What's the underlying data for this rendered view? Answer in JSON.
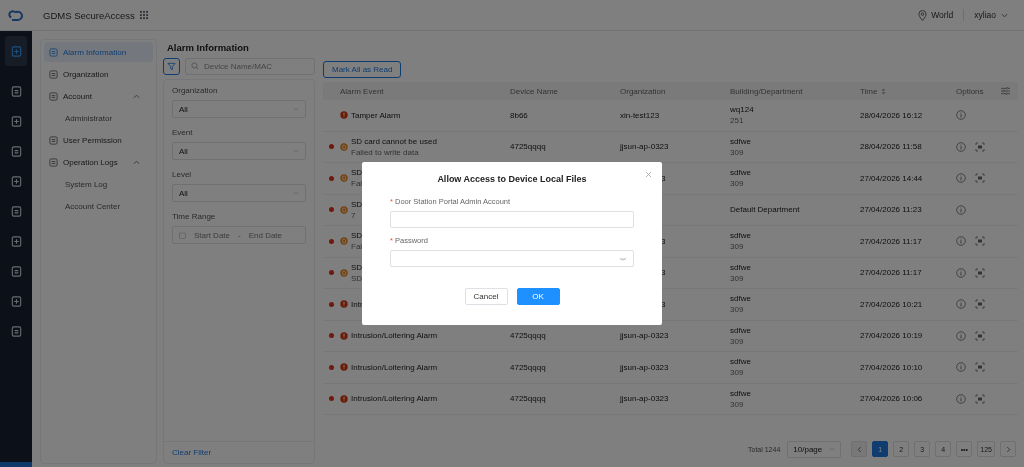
{
  "header": {
    "product": "GDMS SecureAccess",
    "region": "World",
    "user": "xyliao"
  },
  "rail": [
    {
      "selected": true
    },
    {
      "selected": false
    },
    {
      "selected": false
    },
    {
      "selected": false
    },
    {
      "selected": false
    },
    {
      "selected": false
    },
    {
      "selected": false
    },
    {
      "selected": false
    },
    {
      "selected": false
    },
    {
      "selected": false
    }
  ],
  "nav": [
    {
      "label": "Alarm Information",
      "selected": true
    },
    {
      "label": "Organization",
      "selected": false
    },
    {
      "label": "Account",
      "selected": false,
      "expanded": true,
      "children": [
        {
          "label": "Administrator",
          "selected": false
        }
      ]
    },
    {
      "label": "User Permission",
      "selected": false
    },
    {
      "label": "Operation Logs",
      "selected": false,
      "expanded": true,
      "children": [
        {
          "label": "System Log",
          "selected": false
        },
        {
          "label": "Account Center",
          "selected": false
        }
      ]
    }
  ],
  "page_title": "Alarm Information",
  "search": {
    "placeholder": "Device Name/MAC"
  },
  "mark_all_button": "Mark All as Read",
  "filters": [
    {
      "label": "Organization",
      "value": "All"
    },
    {
      "label": "Event",
      "value": "All"
    },
    {
      "label": "Level",
      "value": "All"
    }
  ],
  "time_range": {
    "label": "Time Range",
    "start_placeholder": "Start Date",
    "separator": "-",
    "end_placeholder": "End Date"
  },
  "clear_filter": "Clear Filter",
  "table": {
    "columns": [
      "Alarm Event",
      "Device Name",
      "Organization",
      "Building/Department",
      "Time",
      "Options"
    ],
    "rows": [
      {
        "unread": false,
        "kind": "alert",
        "event": "Tamper Alarm",
        "device": "8b66",
        "organization": "xin-test123",
        "building": "wq124",
        "department": "251",
        "time": "28/04/2026 16:12",
        "capture": false
      },
      {
        "unread": true,
        "kind": "sd_card",
        "event": "SD card cannot be used",
        "detail": "Failed to write data",
        "device": "4725qqqq",
        "organization": "jjsun-ap-0323",
        "building": "sdfwe",
        "department": "309",
        "time": "28/04/2026 11:58",
        "capture": true
      },
      {
        "unread": true,
        "kind": "sd_card",
        "covered": true,
        "event": "SD",
        "detail": "Fai",
        "organization": "3",
        "building": "sdfwe",
        "department": "309",
        "time": "27/04/2026 14:44",
        "capture": true
      },
      {
        "unread": true,
        "kind": "sd_card",
        "covered": true,
        "event": "SD",
        "detail": "7",
        "building": "Default Department",
        "time": "27/04/2026 11:23",
        "capture": false
      },
      {
        "unread": true,
        "kind": "sd_card",
        "covered": true,
        "event": "SD",
        "detail": "Fai",
        "organization": "3",
        "building": "sdfwe",
        "department": "309",
        "time": "27/04/2026 11:17",
        "capture": true
      },
      {
        "unread": true,
        "kind": "sd_card",
        "covered": true,
        "event": "SD",
        "detail": "SD",
        "organization": "3",
        "building": "sdfwe",
        "department": "309",
        "time": "27/04/2026 11:17",
        "capture": true
      },
      {
        "unread": true,
        "kind": "alert",
        "covered": true,
        "event": "Intr",
        "organization": "3",
        "building": "sdfwe",
        "department": "309",
        "time": "27/04/2026 10:21",
        "capture": true
      },
      {
        "unread": true,
        "kind": "alert",
        "event": "Intrusion/Loitering Alarm",
        "device": "4725qqqq",
        "organization": "jjsun-ap-0323",
        "building": "sdfwe",
        "department": "309",
        "time": "27/04/2026 10:19",
        "capture": true
      },
      {
        "unread": true,
        "kind": "alert",
        "event": "Intrusion/Loitering Alarm",
        "device": "4725qqqq",
        "organization": "jjsun-ap-0323",
        "building": "sdfwe",
        "department": "309",
        "time": "27/04/2026 10:10",
        "capture": true
      },
      {
        "unread": true,
        "kind": "alert",
        "event": "Intrusion/Loitering Alarm",
        "device": "4725qqqq",
        "organization": "jjsun-ap-0323",
        "building": "sdfwe",
        "department": "309",
        "time": "27/04/2026 10:06",
        "capture": true
      }
    ]
  },
  "pagination": {
    "total": "Total 1244",
    "page_size": "10/page",
    "pages": [
      {
        "label": "1",
        "selected": true
      },
      {
        "label": "2",
        "selected": false
      },
      {
        "label": "3",
        "selected": false
      },
      {
        "label": "4",
        "selected": false
      },
      {
        "label": "•••",
        "selected": false
      },
      {
        "label": "125",
        "selected": false
      }
    ]
  },
  "dialog": {
    "title": "Allow Access to Device Local Files",
    "fields": [
      {
        "kind": "text",
        "label": "Door Station Portal Admin Account",
        "required_mark": "*"
      },
      {
        "kind": "password",
        "label": "Password",
        "required_mark": "*"
      }
    ],
    "buttons": [
      {
        "kind": "secondary",
        "label": "Cancel"
      },
      {
        "kind": "primary",
        "label": "OK"
      }
    ]
  }
}
